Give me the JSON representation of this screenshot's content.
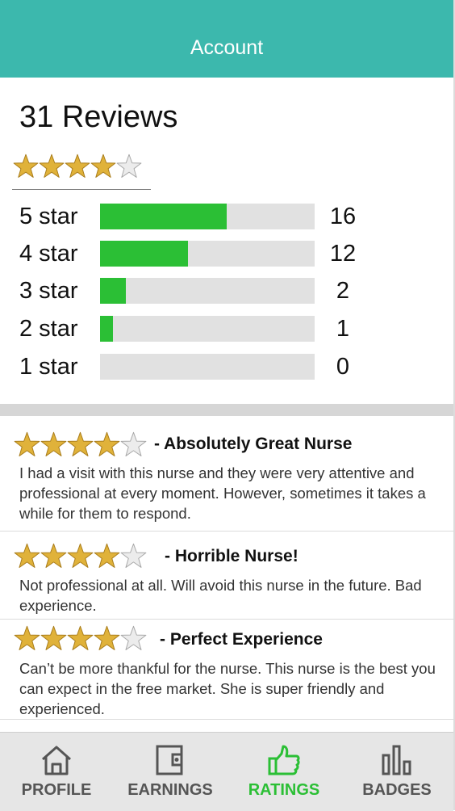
{
  "header": {
    "title": "Account"
  },
  "summary": {
    "title": "31 Reviews",
    "rating": 4,
    "max_rating": 5,
    "distribution": [
      {
        "label": "5 star",
        "count": "16",
        "fill": 0.59
      },
      {
        "label": "4 star",
        "count": "12",
        "fill": 0.41
      },
      {
        "label": "3 star",
        "count": "2",
        "fill": 0.12
      },
      {
        "label": "2 star",
        "count": "1",
        "fill": 0.06
      },
      {
        "label": "1 star",
        "count": "0",
        "fill": 0
      }
    ]
  },
  "reviews": [
    {
      "rating": 4,
      "title": "- Absolutely Great Nurse",
      "body": "I had a visit with this nurse and they were very attentive and professional at every moment. However, sometimes it takes a while for them to respond."
    },
    {
      "rating": 4,
      "title": "- Horrible Nurse!",
      "body": "Not professional at all. Will avoid this nurse in the future. Bad experience."
    },
    {
      "rating": 4,
      "title": "- Perfect Experience",
      "body": "Can’t be more thankful for the nurse. This nurse is the best you can expect in the free market. She is super friendly and experienced."
    }
  ],
  "tabs": [
    {
      "label": "PROFILE",
      "icon": "home-icon",
      "active": false
    },
    {
      "label": "EARNINGS",
      "icon": "wallet-icon",
      "active": false
    },
    {
      "label": "RATINGS",
      "icon": "thumbs-up-icon",
      "active": true
    },
    {
      "label": "BADGES",
      "icon": "bar-chart-icon",
      "active": false
    }
  ],
  "colors": {
    "header": "#3cb8ad",
    "bar_fill": "#2bbf35",
    "bar_track": "#e1e1e1",
    "star_filled": "#e0b23a",
    "star_empty": "#ececec",
    "active_tab": "#2bbf35"
  }
}
